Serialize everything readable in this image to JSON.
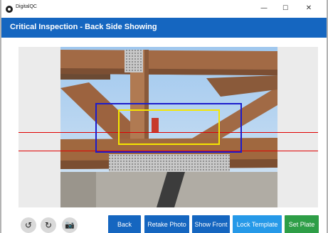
{
  "window": {
    "app_title": "DigitalQC",
    "minimize_glyph": "—",
    "maximize_glyph": "☐",
    "close_glyph": "✕"
  },
  "header": {
    "title": "Critical Inspection - Back Side Showing"
  },
  "toolbar": {
    "rotate_left_icon": "rotate-left-icon",
    "rotate_left_glyph": "↺",
    "rotate_right_icon": "rotate-right-icon",
    "rotate_right_glyph": "↻",
    "camera_icon": "camera-icon",
    "camera_glyph": "📷"
  },
  "actions": {
    "back_label": "Back",
    "retake_label": "Retake Photo",
    "show_front_label": "Show Front",
    "lock_template_label": "Lock Template",
    "set_plate_label": "Set Plate"
  },
  "colors": {
    "header_bg": "#1566c0",
    "primary_button": "#1566c0",
    "lock_button": "#2699e8",
    "set_plate_button": "#2e9e47",
    "reference_lines": "#e00000",
    "outer_box": "#1c1ccc",
    "inner_box": "#f5e600"
  }
}
